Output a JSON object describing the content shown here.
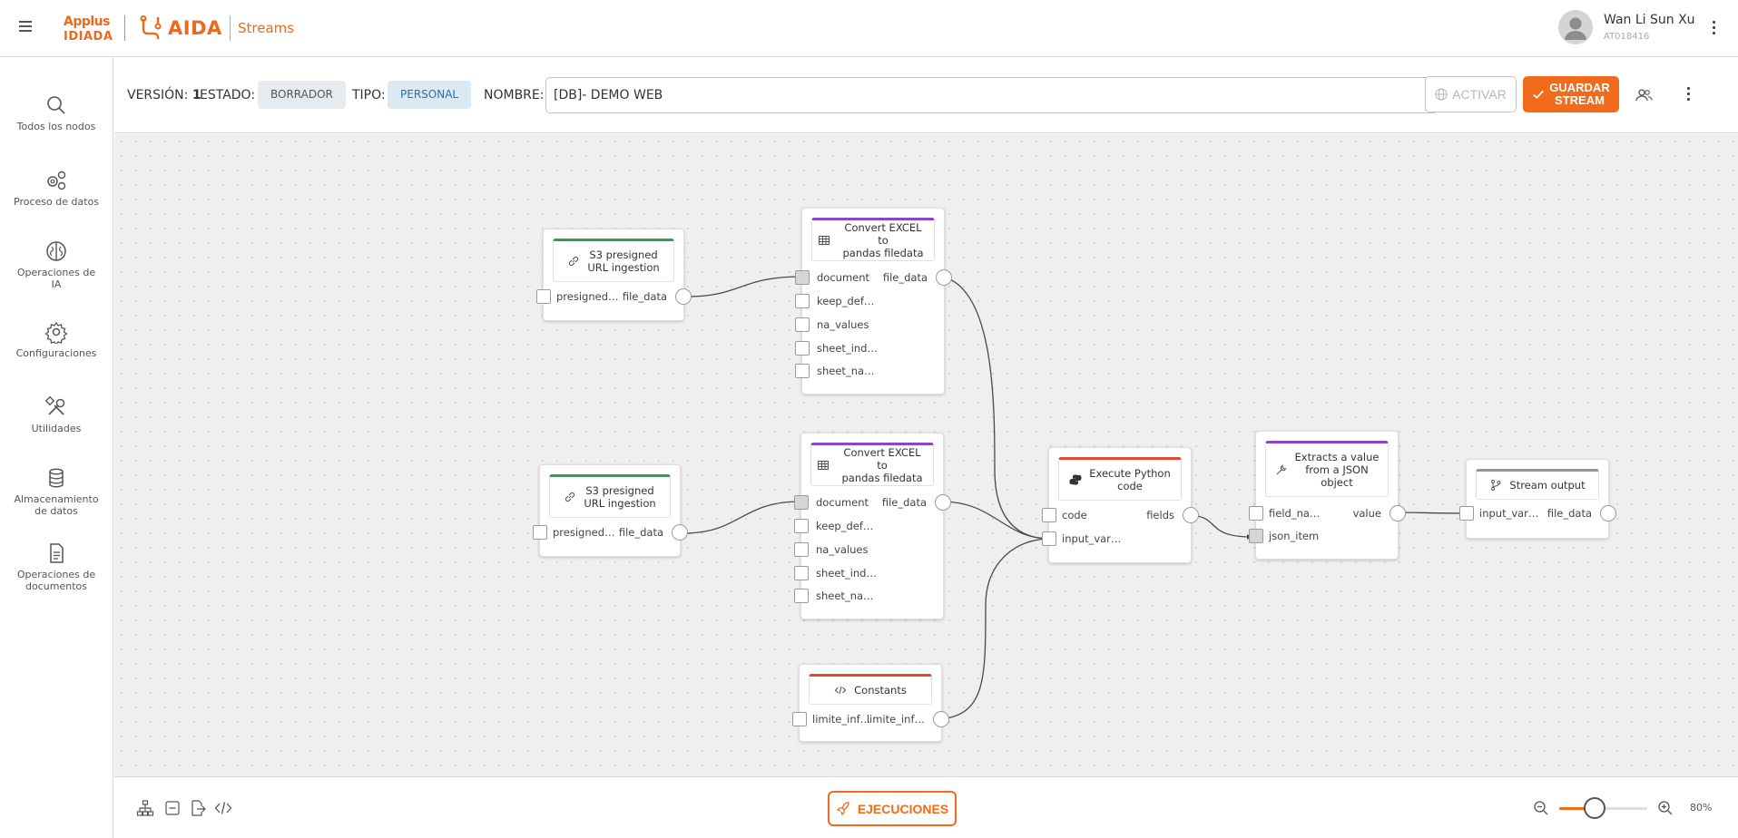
{
  "header": {
    "logo_applus_top": "Applus",
    "logo_applus_bottom": "IDIADA",
    "logo_aida": "AIDA",
    "app_section": "Streams",
    "user_name": "Wan Li Sun Xu",
    "user_id": "AT018416"
  },
  "sidebar": {
    "items": [
      {
        "label": "Todos los nodos",
        "icon": "search-icon"
      },
      {
        "label": "Proceso de datos",
        "icon": "gears-icon"
      },
      {
        "label": "Operaciones de IA",
        "icon": "brain-icon"
      },
      {
        "label": "Configuraciones",
        "icon": "gear-icon"
      },
      {
        "label": "Utilidades",
        "icon": "tools-icon"
      },
      {
        "label": "Almacenamiento de datos",
        "icon": "database-icon"
      },
      {
        "label": "Operaciones de documentos",
        "icon": "document-icon"
      }
    ]
  },
  "toolbar": {
    "version_label": "VERSIÓN:",
    "version_value": "1",
    "estado_label": "ESTADO:",
    "estado_value": "BORRADOR",
    "tipo_label": "TIPO:",
    "tipo_value": "PERSONAL",
    "nombre_label": "NOMBRE:",
    "nombre_value": "[DB]- DEMO WEB",
    "activar_label": "ACTIVAR",
    "guardar_line1": "GUARDAR",
    "guardar_line2": "STREAM"
  },
  "nodes": {
    "s3_a": {
      "title_1": "S3 presigned",
      "title_2": "URL ingestion",
      "in": "presigned…",
      "out": "file_data",
      "color": "#2e9e5b"
    },
    "s3_b": {
      "title_1": "S3 presigned",
      "title_2": "URL ingestion",
      "in": "presigned…",
      "out": "file_data",
      "color": "#2e9e5b"
    },
    "excel_a": {
      "title_1": "Convert EXCEL to",
      "title_2": "pandas filedata",
      "inputs": [
        "document",
        "keep_def…",
        "na_values",
        "sheet_ind…",
        "sheet_na…"
      ],
      "out": "file_data",
      "color": "#8e44c9"
    },
    "excel_b": {
      "title_1": "Convert EXCEL to",
      "title_2": "pandas filedata",
      "inputs": [
        "document",
        "keep_def…",
        "na_values",
        "sheet_ind…",
        "sheet_na…"
      ],
      "out": "file_data",
      "color": "#8e44c9"
    },
    "constants": {
      "title_1": "Constants",
      "in": "limite_inf…",
      "out": "limite_inf…",
      "color": "#e04a2f"
    },
    "python": {
      "title_1": "Execute Python",
      "title_2": "code",
      "inputs": [
        "code",
        "input_var…"
      ],
      "out": "fields",
      "color": "#e04a2f"
    },
    "json": {
      "title_1": "Extracts a value",
      "title_2": "from a JSON",
      "title_3": "object",
      "inputs": [
        "field_na…",
        "json_item"
      ],
      "out": "value",
      "color": "#8e44c9"
    },
    "output": {
      "title_1": "Stream output",
      "in": "input_var…",
      "out": "file_data",
      "color": "#8a9a98"
    }
  },
  "bottombar": {
    "ejecuciones_label": "EJECUCIONES",
    "zoom_label": "80%",
    "zoom_fraction": 0.4
  },
  "colors": {
    "accent": "#f26b1b",
    "canvas": "#f1efed"
  }
}
